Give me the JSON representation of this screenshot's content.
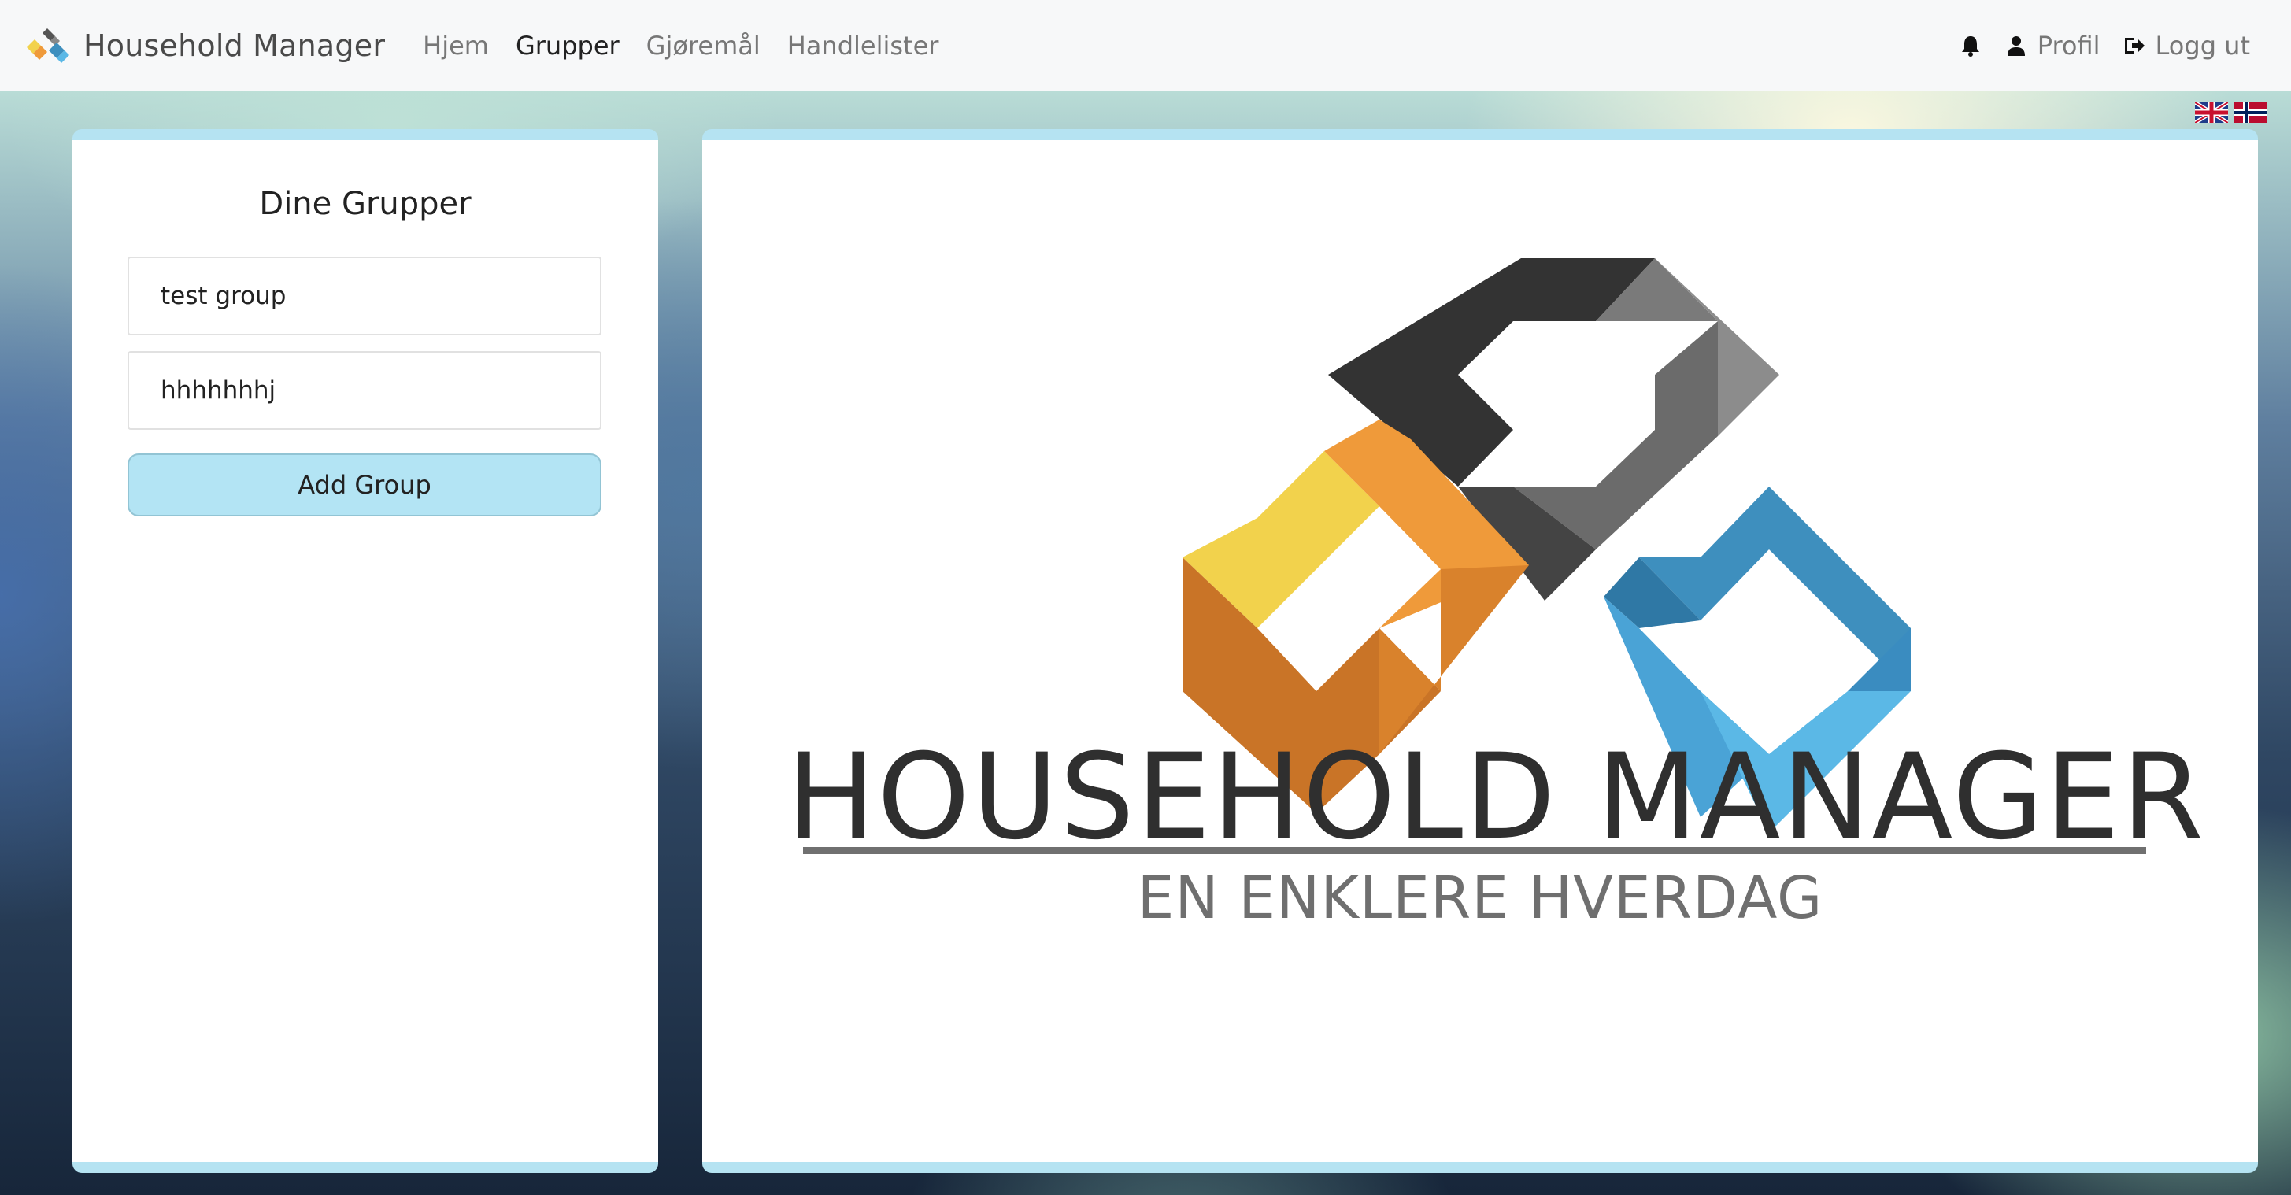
{
  "navbar": {
    "brand": "Household Manager",
    "links": [
      {
        "label": "Hjem",
        "active": false
      },
      {
        "label": "Grupper",
        "active": true
      },
      {
        "label": "Gjøremål",
        "active": false
      },
      {
        "label": "Handlelister",
        "active": false
      }
    ],
    "profile_label": "Profil",
    "logout_label": "Logg ut",
    "icons": [
      "bell-icon",
      "user-icon",
      "logout-icon"
    ]
  },
  "languages": [
    "uk-flag-icon",
    "norway-flag-icon"
  ],
  "groups_panel": {
    "title": "Dine Grupper",
    "groups": [
      "test group",
      "hhhhhhhj"
    ],
    "add_button": "Add Group"
  },
  "hero": {
    "title": "HOUSEHOLD MANAGER",
    "subtitle": "EN ENKLERE HVERDAG"
  },
  "colors": {
    "accent": "#b5e3f2",
    "logo_dark": "#333333",
    "logo_orange": "#ef9a3a",
    "logo_yellow": "#f2d24c",
    "logo_blue": "#3e8fbe"
  }
}
